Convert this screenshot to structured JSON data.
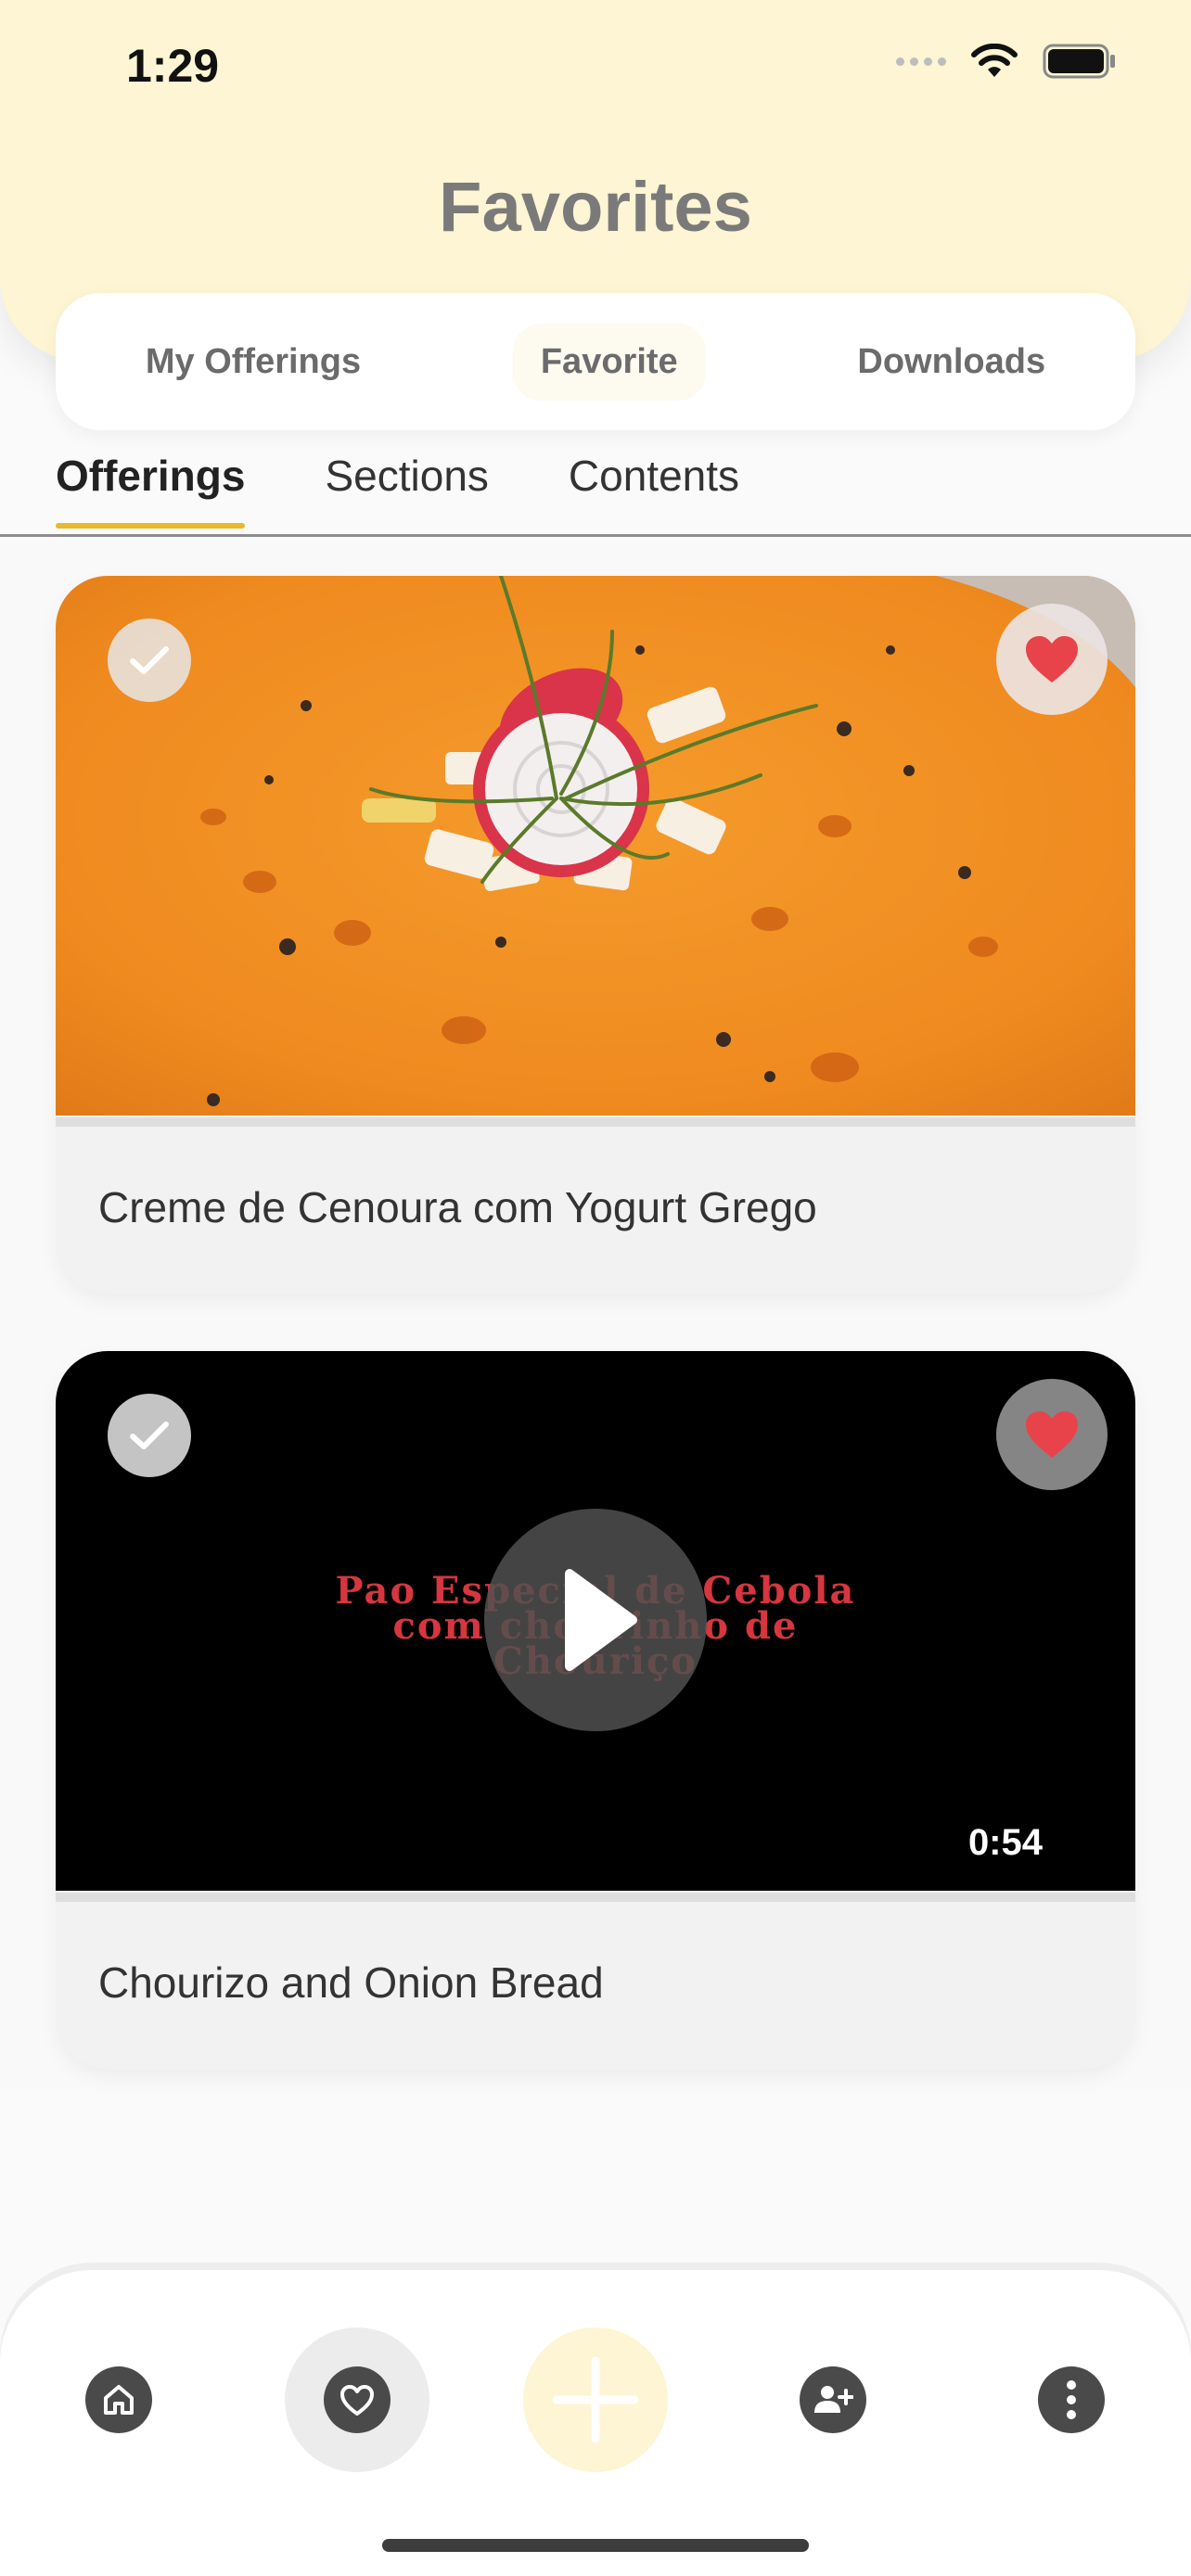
{
  "status_bar": {
    "time": "1:29"
  },
  "header": {
    "title": "Favorites"
  },
  "segments": [
    {
      "label": "My Offerings"
    },
    {
      "label": "Favorite"
    },
    {
      "label": "Downloads"
    }
  ],
  "tabs": [
    {
      "label": "Offerings"
    },
    {
      "label": "Sections"
    },
    {
      "label": "Contents"
    }
  ],
  "cards": [
    {
      "title": "Creme de Cenoura com Yogurt Grego",
      "type": "image",
      "favorited": true,
      "completed": true
    },
    {
      "title": "Chourizo and Onion Bread",
      "type": "video",
      "duration": "0:54",
      "video_text": [
        "Pao Especial de Cebola",
        "com chourinho de",
        "Chouriço"
      ],
      "favorited": true,
      "completed": true
    }
  ],
  "bottom_nav": [
    {
      "icon": "home-icon"
    },
    {
      "icon": "heart-icon",
      "selected": true
    },
    {
      "icon": "plus-icon"
    },
    {
      "icon": "add-user-icon"
    },
    {
      "icon": "more-vertical-icon"
    }
  ],
  "colors": {
    "accent": "#e9b92b",
    "header_bg": "#fdf5d3",
    "heart": "#e8434b"
  }
}
